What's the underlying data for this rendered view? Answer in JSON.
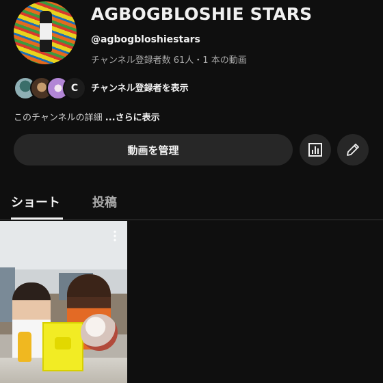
{
  "channel": {
    "title": "AGBOGBLOSHIE STARS",
    "handle": "@agbogbloshiestars",
    "stats": "チャンネル登録者数 61人・1 本の動画",
    "subscribers_link": "チャンネル登録者を表示",
    "description_label": "このチャンネルの詳細 ",
    "description_more": "...さらに表示"
  },
  "actions": {
    "manage_videos_label": "動画を管理",
    "analytics_icon": "analytics-icon",
    "edit_icon": "pencil-icon"
  },
  "tabs": [
    {
      "label": "ショート",
      "selected": true
    },
    {
      "label": "投稿",
      "selected": false
    }
  ],
  "subscriber_avatar_badge": "C",
  "colors": {
    "background": "#0f0f0f",
    "button": "#272727",
    "text_primary": "#f1f1f1",
    "text_secondary": "#aaaaaa"
  }
}
